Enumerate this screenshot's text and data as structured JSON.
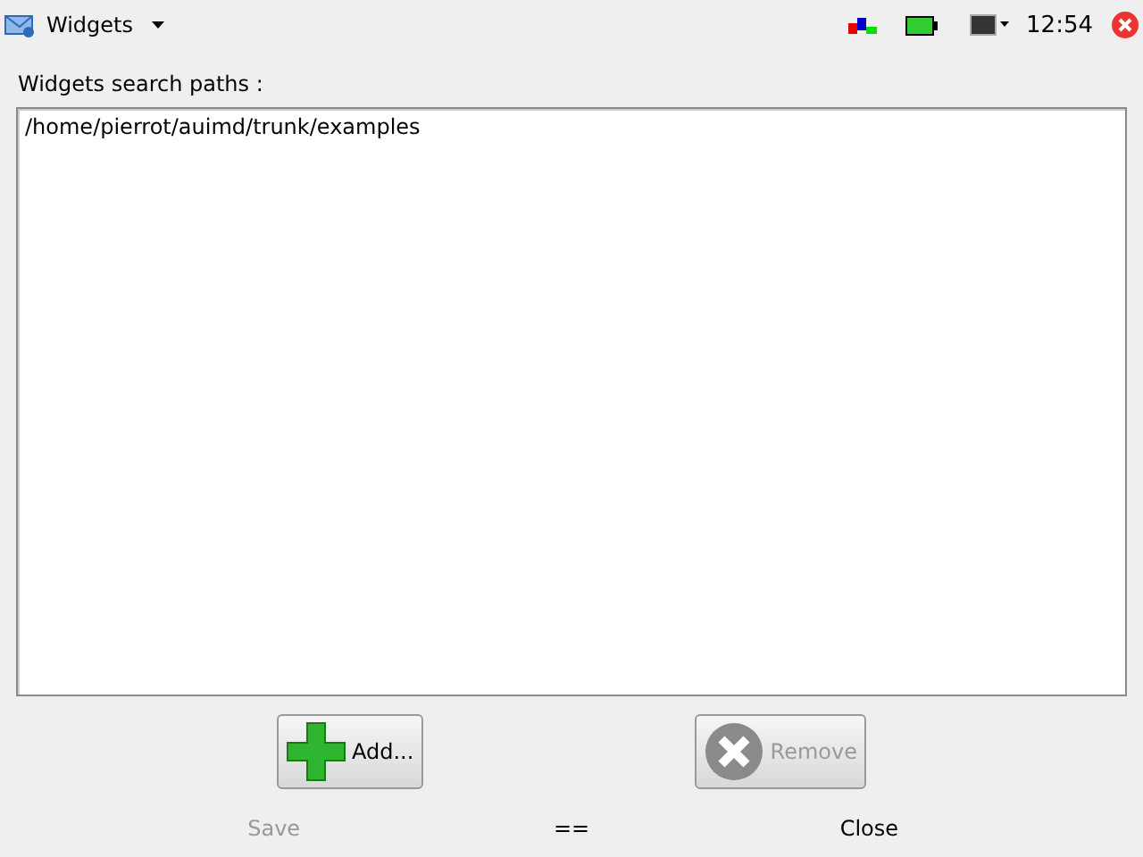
{
  "top_bar": {
    "app_title": "Widgets",
    "time": "12:54"
  },
  "label": "Widgets search paths :",
  "paths": [
    {
      "text": "/home/pierrot/auimd/trunk/examples",
      "selected": false
    }
  ],
  "buttons": [
    {
      "kind": "add",
      "label": "Add...",
      "disabled": false
    },
    {
      "kind": "remove",
      "label": "Remove",
      "disabled": true
    }
  ],
  "softkeys": [
    {
      "label": "Save",
      "disabled": true
    },
    {
      "label": "==",
      "disabled": false
    },
    {
      "label": "Close",
      "disabled": false
    }
  ]
}
